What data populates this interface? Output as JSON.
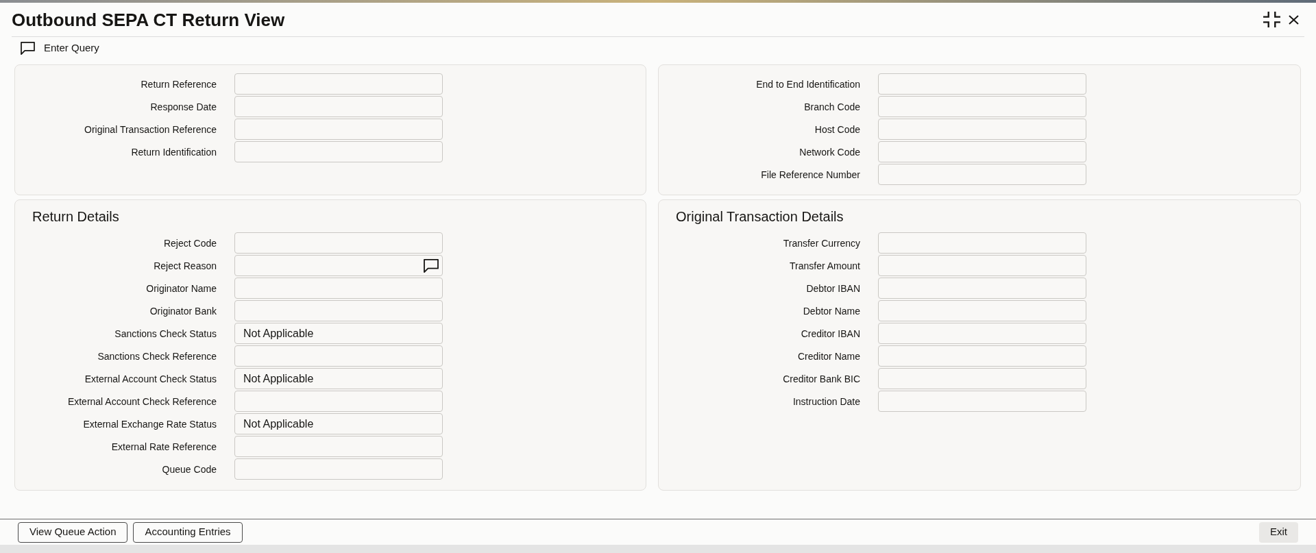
{
  "window": {
    "title": "Outbound SEPA CT Return View"
  },
  "toolbar": {
    "buttons": [
      {
        "label": "Enter Query"
      }
    ]
  },
  "query": {
    "left": [
      {
        "label": "Return Reference",
        "kind": "text"
      },
      {
        "label": "Response Date",
        "kind": "text"
      },
      {
        "label": "Original Transaction Reference",
        "kind": "text"
      },
      {
        "label": "Return Identification",
        "kind": "text"
      }
    ],
    "right": [
      {
        "label": "End to End Identification",
        "kind": "text"
      },
      {
        "label": "Branch Code",
        "kind": "text"
      },
      {
        "label": "Host Code",
        "kind": "text"
      },
      {
        "label": "Network Code",
        "kind": "text"
      },
      {
        "label": "File Reference Number",
        "kind": "text"
      }
    ]
  },
  "sections": [
    {
      "title": "Return Details",
      "fields": [
        {
          "label": "Reject Code",
          "kind": "text"
        },
        {
          "label": "Reject Reason",
          "kind": "note"
        },
        {
          "label": "Originator Name",
          "kind": "text"
        },
        {
          "label": "Originator Bank",
          "kind": "text"
        },
        {
          "label": "Sanctions Check Status",
          "value": "Not Applicable",
          "kind": "text"
        },
        {
          "label": "Sanctions Check Reference",
          "kind": "text"
        },
        {
          "label": "External Account Check Status",
          "value": "Not Applicable",
          "kind": "text"
        },
        {
          "label": "External Account Check Reference",
          "kind": "text"
        },
        {
          "label": "External Exchange Rate Status",
          "value": "Not Applicable",
          "kind": "text"
        },
        {
          "label": "External Rate Reference",
          "kind": "text"
        },
        {
          "label": "Queue Code",
          "kind": "text"
        }
      ]
    },
    {
      "title": "Original Transaction Details",
      "fields": [
        {
          "label": "Transfer Currency",
          "kind": "text"
        },
        {
          "label": "Transfer Amount",
          "kind": "text"
        },
        {
          "label": "Debtor IBAN",
          "kind": "text"
        },
        {
          "label": "Debtor Name",
          "kind": "text"
        },
        {
          "label": "Creditor IBAN",
          "kind": "text"
        },
        {
          "label": "Creditor Name",
          "kind": "text"
        },
        {
          "label": "Creditor Bank BIC",
          "kind": "text"
        },
        {
          "label": "Instruction Date",
          "kind": "text"
        }
      ]
    }
  ],
  "footer": {
    "buttons": [
      {
        "label": "View Queue Action",
        "kind": "outlined"
      },
      {
        "label": "Accounting Entries",
        "kind": "outlined"
      },
      {
        "label": "Exit",
        "kind": "filled"
      }
    ]
  }
}
